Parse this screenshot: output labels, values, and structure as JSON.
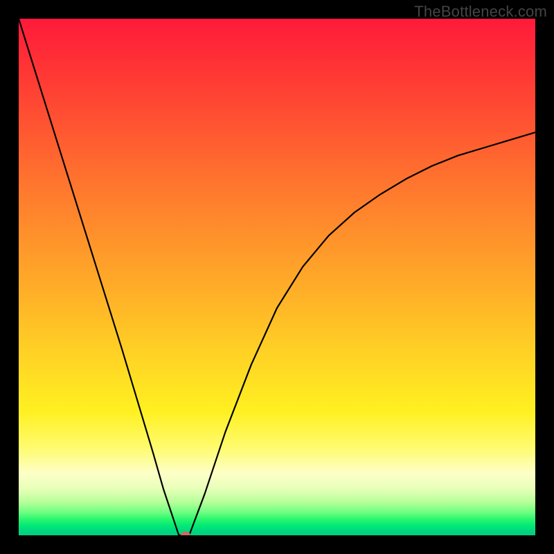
{
  "watermark": "TheBottleneck.com",
  "chart_data": {
    "type": "line",
    "title": "",
    "xlabel": "",
    "ylabel": "",
    "xlim": [
      0,
      100
    ],
    "ylim": [
      0,
      100
    ],
    "grid": false,
    "legend": false,
    "annotations": [],
    "x": [
      0,
      5,
      10,
      15,
      20,
      23,
      26,
      28,
      30,
      31,
      33,
      36,
      40,
      45,
      50,
      55,
      60,
      65,
      70,
      75,
      80,
      85,
      90,
      95,
      100
    ],
    "values": [
      100,
      84,
      68,
      52,
      36,
      26,
      16,
      9,
      3,
      0,
      0,
      8,
      20,
      33,
      44,
      52,
      58,
      62.5,
      66,
      69,
      71.5,
      73.5,
      75,
      76.5,
      78
    ],
    "marker": {
      "x": 32.3,
      "y": 0
    },
    "background_gradient": {
      "top": "#ff1a3a",
      "bottom": "#00cf7f"
    }
  }
}
